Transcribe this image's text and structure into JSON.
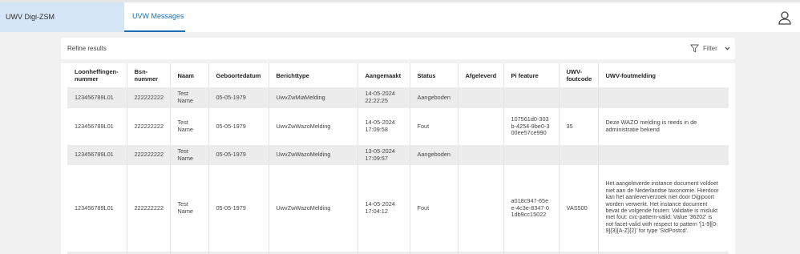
{
  "header": {
    "brand": "UWV Digi-ZSM",
    "tab": "UVW Messages",
    "user_icon": "user-icon"
  },
  "toolbar": {
    "refine_label": "Refine results",
    "filter_label": "Filter",
    "filter_icon": "funnel-icon",
    "chevron_icon": "chevron-down-icon"
  },
  "table": {
    "columns": [
      "Loonheffingen-nummer",
      "Bsn-nummer",
      "Naam",
      "Geboortedatum",
      "Berichttype",
      "Aangemaakt",
      "Status",
      "Afgeleverd",
      "Pi feature",
      "UWV-foutcode",
      "UWV-foutmelding"
    ],
    "rows": [
      {
        "loonheffingennummer": "123456789L01",
        "bsn": "222222222",
        "naam": "Test Name",
        "geboortedatum": "05-05-1979",
        "berichttype": "UwvZwMiaMelding",
        "aangemaakt": "14-05-2024 22:22:25",
        "status": "Aangeboden",
        "afgeleverd": "",
        "pi_feature": "",
        "foutcode": "",
        "foutmelding": ""
      },
      {
        "loonheffingennummer": "123456789L01",
        "bsn": "222222222",
        "naam": "Test Name",
        "geboortedatum": "05-05-1979",
        "berichttype": "UwvZwWazoMelding",
        "aangemaakt": "14-05-2024 17:09:58",
        "status": "Fout",
        "afgeleverd": "",
        "pi_feature": "107561d0-303b-4254-9be0-300ee57ce990",
        "foutcode": "35",
        "foutmelding": "Deze WAZO melding is reeds in de administratie bekend"
      },
      {
        "loonheffingennummer": "123456789L01",
        "bsn": "222222222",
        "naam": "Test Name",
        "geboortedatum": "05-05-1979",
        "berichttype": "UwvZwWazoMelding",
        "aangemaakt": "13-05-2024 17:09:57",
        "status": "Aangeboden",
        "afgeleverd": "",
        "pi_feature": "",
        "foutcode": "",
        "foutmelding": ""
      },
      {
        "loonheffingennummer": "123456789L01",
        "bsn": "222222222",
        "naam": "Test Name",
        "geboortedatum": "05-05-1979",
        "berichttype": "UwvZwWazoMelding",
        "aangemaakt": "14-05-2024 17:04:12",
        "status": "Fout",
        "afgeleverd": "",
        "pi_feature": "a018c947-65ee-4c3e-8347-01db9cc15022",
        "foutcode": "VAS500",
        "foutmelding": "Het aangeleverde instance document voldoet niet aan de Nederlandse taxonomie. Hierdoor kan het aanleververzoek niet door Digipoort worden verwerkt. Het instance document bevat de volgende fouten: Validatie is mislukt met fout: cvc-pattern-valid: Value '36202' is not facet-valid with respect to pattern '[1-9][0-9]{3}[A-Z]{2}' for type 'StdPostcd'."
      }
    ]
  }
}
